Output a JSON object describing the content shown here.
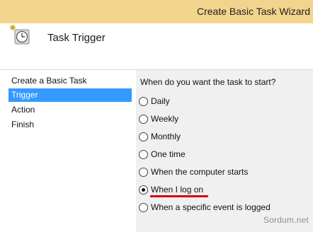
{
  "window": {
    "title": "Create Basic Task Wizard"
  },
  "header": {
    "title": "Task Trigger",
    "icon": "clock-icon"
  },
  "sidebar": {
    "items": [
      {
        "label": "Create a Basic Task",
        "active": false
      },
      {
        "label": "Trigger",
        "active": true
      },
      {
        "label": "Action",
        "active": false
      },
      {
        "label": "Finish",
        "active": false
      }
    ]
  },
  "trigger": {
    "question": "When do you want the task to start?",
    "options": [
      {
        "label": "Daily",
        "selected": false
      },
      {
        "label": "Weekly",
        "selected": false
      },
      {
        "label": "Monthly",
        "selected": false
      },
      {
        "label": "One time",
        "selected": false
      },
      {
        "label": "When the computer starts",
        "selected": false
      },
      {
        "label": "When I log on",
        "selected": true
      },
      {
        "label": "When a specific event is logged",
        "selected": false
      }
    ]
  },
  "watermark": "Sordum.net",
  "colors": {
    "titlebar": "#f3d48d",
    "selection": "#3399ff",
    "highlight_underline": "#d30000",
    "content_bg": "#f0f0f0"
  }
}
